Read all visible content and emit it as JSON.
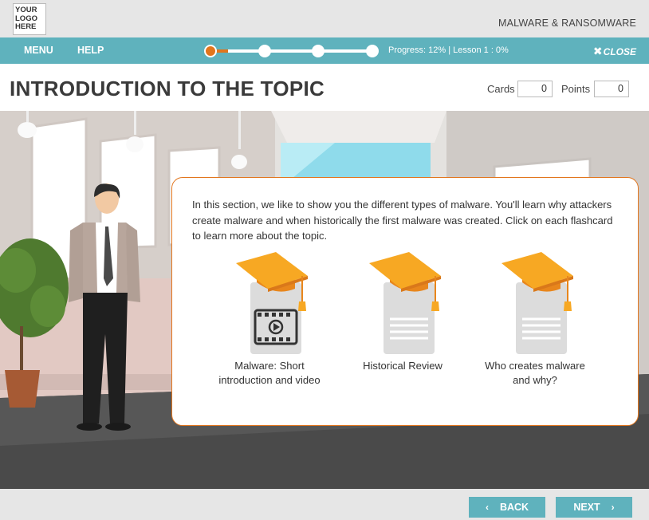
{
  "logo": {
    "lines": [
      "YOUR",
      "LOGO",
      "HERE"
    ]
  },
  "course_title": "MALWARE & RANSOMWARE",
  "nav": {
    "menu_label": "MENU",
    "help_label": "HELP",
    "progress_text": "Progress: 12% | Lesson 1 : 0%",
    "progress_percent": 12,
    "close_label": "CLOSE",
    "close_icon": "x-icon",
    "accent_color": "#5fb2bd",
    "progress_color": "#e2751c"
  },
  "header": {
    "title": "INTRODUCTION TO THE TOPIC",
    "cards_label": "Cards",
    "cards_value": "0",
    "points_label": "Points",
    "points_value": "0"
  },
  "content": {
    "intro": "In this section, we like to show you the different types of malware. You'll learn why attackers create malware and when historically the first malware was created. Click on each flashcard to learn more about the topic.",
    "flashcards": [
      {
        "label": "Malware: Short introduction and video",
        "icon": "video-card-icon"
      },
      {
        "label": "Historical Review",
        "icon": "document-card-icon"
      },
      {
        "label": "Who creates malware and why?",
        "icon": "document-card-icon"
      }
    ]
  },
  "footer": {
    "back_label": "BACK",
    "next_label": "NEXT"
  }
}
